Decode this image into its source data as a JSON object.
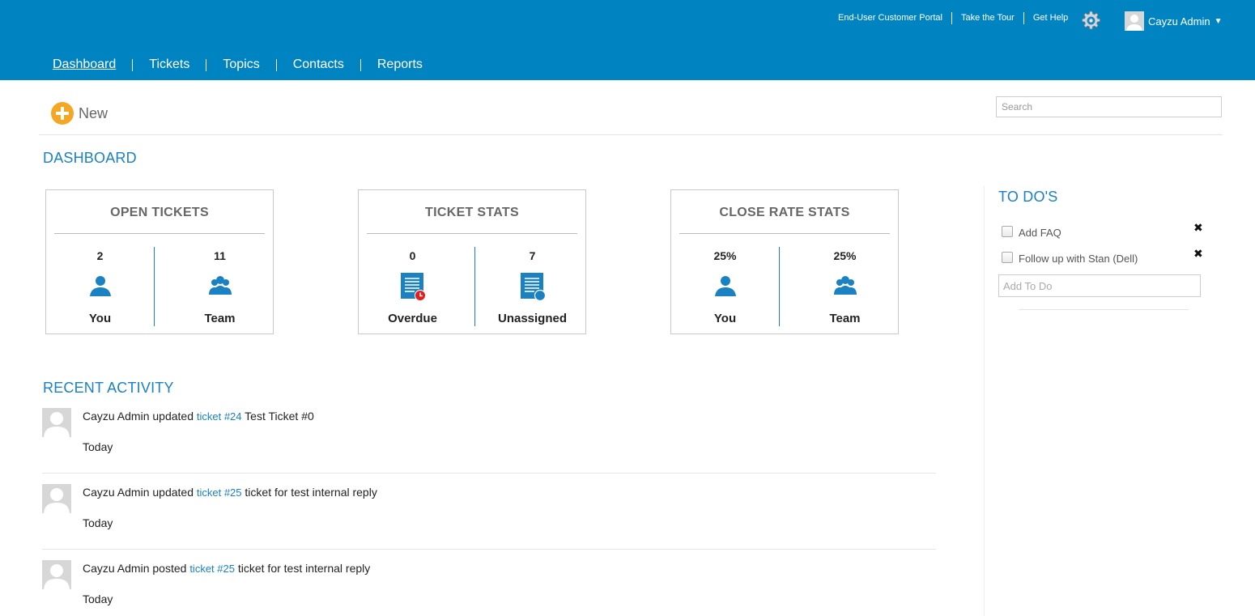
{
  "header": {
    "util_links": [
      "End-User Customer Portal",
      "Take the Tour",
      "Get Help"
    ],
    "user_name": "Cayzu Admin",
    "caret": "▼",
    "nav": [
      "Dashboard",
      "Tickets",
      "Topics",
      "Contacts",
      "Reports"
    ],
    "active_nav": "Dashboard",
    "brand_color": "#0083c1"
  },
  "toolbar": {
    "new_label": "New",
    "search_placeholder": "Search"
  },
  "dashboard": {
    "title": "DASHBOARD",
    "cards": [
      {
        "title": "OPEN TICKETS",
        "cols": [
          {
            "value": "2",
            "label": "You",
            "icon": "user-icon"
          },
          {
            "value": "11",
            "label": "Team",
            "icon": "team-icon"
          }
        ]
      },
      {
        "title": "TICKET STATS",
        "cols": [
          {
            "value": "0",
            "label": "Overdue",
            "icon": "overdue-ticket-icon"
          },
          {
            "value": "7",
            "label": "Unassigned",
            "icon": "unassigned-ticket-icon"
          }
        ]
      },
      {
        "title": "CLOSE RATE STATS",
        "cols": [
          {
            "value": "25%",
            "label": "You",
            "icon": "user-icon"
          },
          {
            "value": "25%",
            "label": "Team",
            "icon": "team-icon"
          }
        ]
      }
    ]
  },
  "recent": {
    "title": "RECENT ACTIVITY",
    "items": [
      {
        "actor": "Cayzu Admin",
        "verb": "updated",
        "ticket": "ticket #24",
        "subject": "Test Ticket #0",
        "when": "Today"
      },
      {
        "actor": "Cayzu Admin",
        "verb": "updated",
        "ticket": "ticket #25",
        "subject": "ticket for test internal reply",
        "when": "Today"
      },
      {
        "actor": "Cayzu Admin",
        "verb": "posted",
        "ticket": "ticket #25",
        "subject": "ticket for test internal reply",
        "when": "Today"
      }
    ]
  },
  "todo": {
    "title": "TO DO'S",
    "items": [
      "Add FAQ",
      "Follow up with Stan (Dell)"
    ],
    "remove_glyph": "✖",
    "add_placeholder": "Add To Do"
  }
}
